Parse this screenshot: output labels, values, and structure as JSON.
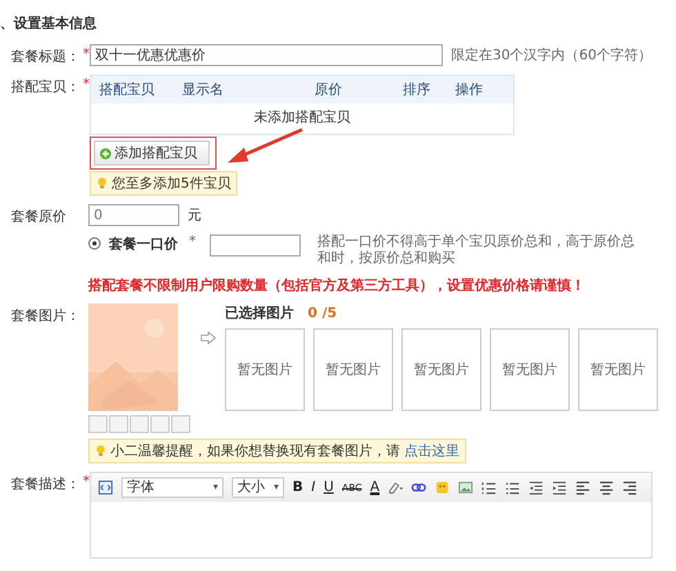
{
  "section_title": "、设置基本信息",
  "title_field": {
    "label": "套餐标题：",
    "required_mark": "*",
    "value": "双十一优惠优惠价",
    "hint": "限定在30个汉字内（60个字符）"
  },
  "products": {
    "label": "搭配宝贝：",
    "required_mark": "*",
    "columns": [
      "搭配宝贝",
      "显示名",
      "原价",
      "排序",
      "操作"
    ],
    "empty_text": "未添加搭配宝贝",
    "add_button": "添加搭配宝贝",
    "tip": "您至多添加5件宝贝"
  },
  "original_price": {
    "label": "套餐原价",
    "placeholder": "0",
    "unit": "元"
  },
  "fixed_price": {
    "label": "套餐一口价",
    "selected": true,
    "required_mark": "*",
    "hint": "搭配一口价不得高于单个宝贝原价总和，高于原价总和时，按原价总和购买"
  },
  "warning": "搭配套餐不限制用户限购数量（包括官方及第三方工具），设置优惠价格请谨慎！",
  "images": {
    "label": "套餐图片：",
    "selected_label": "已选择图片",
    "count": "0 /5",
    "slots": [
      "暂无图片",
      "暂无图片",
      "暂无图片",
      "暂无图片",
      "暂无图片"
    ],
    "tip": "小二温馨提醒，如果你想替换现有套餐图片，请",
    "tip_link": "点击这里"
  },
  "description": {
    "label": "套餐描述：",
    "required_mark": "*",
    "font": "字体",
    "size": "大小",
    "caret": "▾",
    "bold": "B",
    "italic": "I",
    "underline": "U",
    "strike": "ABC",
    "text_color": "A"
  }
}
